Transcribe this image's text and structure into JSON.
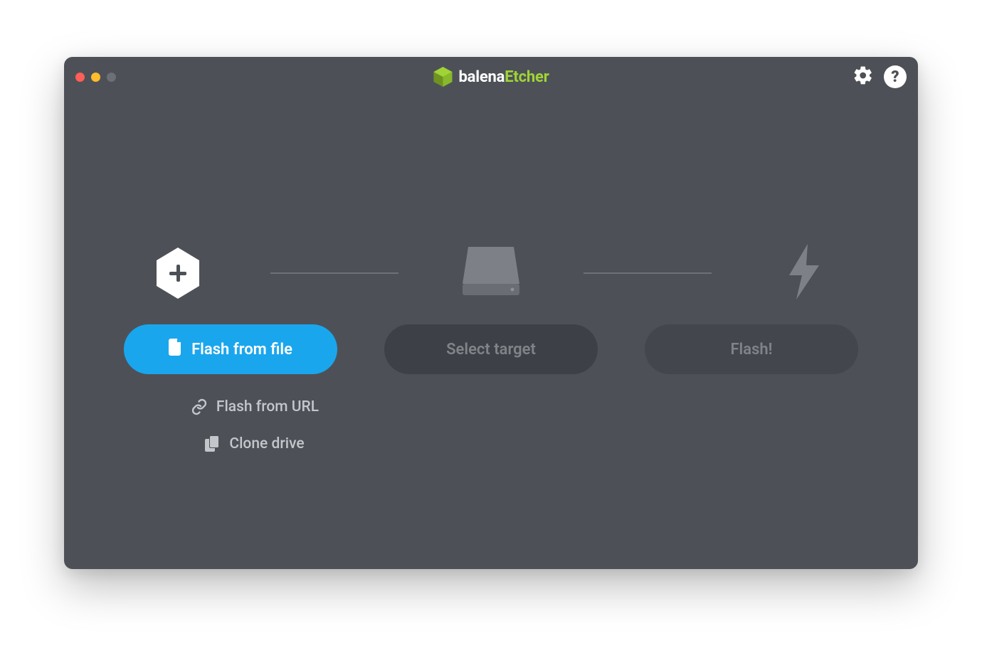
{
  "app": {
    "brand_prefix": "balena",
    "brand_suffix": "Etcher"
  },
  "colors": {
    "accent": "#a0d336",
    "primary_button": "#1aa6ed",
    "window_bg": "#4d5157",
    "disabled_bg": "#3d4147",
    "disabled_text": "#808489"
  },
  "steps": {
    "source": {
      "primary_label": "Flash from file",
      "url_label": "Flash from URL",
      "clone_label": "Clone drive"
    },
    "target": {
      "label": "Select target"
    },
    "flash": {
      "label": "Flash!"
    }
  },
  "titlebar": {
    "help_glyph": "?"
  }
}
